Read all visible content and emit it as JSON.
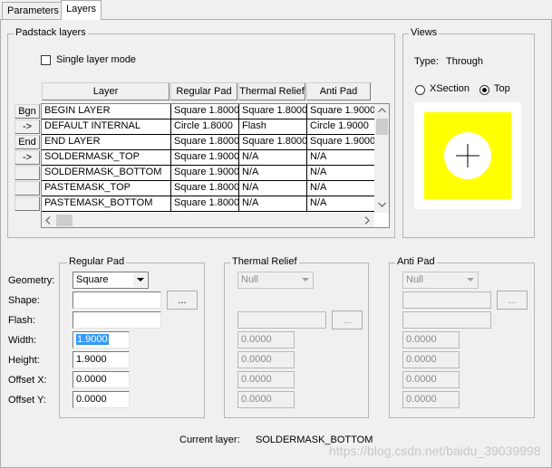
{
  "tabs": [
    {
      "label": "Parameters",
      "active": false
    },
    {
      "label": "Layers",
      "active": true
    }
  ],
  "padstack_layers": {
    "title": "Padstack layers",
    "single_layer_mode_label": "Single layer mode",
    "single_layer_mode_checked": false,
    "columns": [
      "Layer",
      "Regular Pad",
      "Thermal Relief",
      "Anti Pad"
    ],
    "row_buttons": [
      "Bgn",
      "->",
      "End",
      "->",
      "",
      "",
      ""
    ],
    "rows": [
      {
        "layer": "BEGIN LAYER",
        "regular": "Square 1.8000",
        "thermal": "Square 1.8000",
        "anti": "Square 1.9000"
      },
      {
        "layer": "DEFAULT INTERNAL",
        "regular": "Circle 1.8000",
        "thermal": "Flash",
        "anti": "Circle 1.9000"
      },
      {
        "layer": "END LAYER",
        "regular": "Square 1.8000",
        "thermal": "Square 1.8000",
        "anti": "Square 1.9000"
      },
      {
        "layer": "SOLDERMASK_TOP",
        "regular": "Square 1.9000",
        "thermal": "N/A",
        "anti": "N/A"
      },
      {
        "layer": "SOLDERMASK_BOTTOM",
        "regular": "Square 1.9000",
        "thermal": "N/A",
        "anti": "N/A"
      },
      {
        "layer": "PASTEMASK_TOP",
        "regular": "Square 1.8000",
        "thermal": "N/A",
        "anti": "N/A"
      },
      {
        "layer": "PASTEMASK_BOTTOM",
        "regular": "Square 1.8000",
        "thermal": "N/A",
        "anti": "N/A"
      }
    ]
  },
  "views": {
    "title": "Views",
    "type_label": "Type:",
    "type_value": "Through",
    "xsection_label": "XSection",
    "top_label": "Top",
    "selected": "Top",
    "preview_color": "#ffff00"
  },
  "field_labels": {
    "geometry": "Geometry:",
    "shape": "Shape:",
    "flash": "Flash:",
    "width": "Width:",
    "height": "Height:",
    "offset_x": "Offset X:",
    "offset_y": "Offset Y:"
  },
  "regular_pad": {
    "title": "Regular Pad",
    "geometry": "Square",
    "shape": "",
    "flash": "",
    "width": "1.9000",
    "height": "1.9000",
    "offset_x": "0.0000",
    "offset_y": "0.0000",
    "browse_label": "..."
  },
  "thermal_relief": {
    "title": "Thermal Relief",
    "geometry": "Null",
    "flash": "",
    "width": "0.0000",
    "height": "0.0000",
    "offset_x": "0.0000",
    "offset_y": "0.0000",
    "browse_label": "..."
  },
  "anti_pad": {
    "title": "Anti Pad",
    "geometry": "Null",
    "shape": "",
    "flash": "",
    "width": "0.0000",
    "height": "0.0000",
    "offset_x": "0.0000",
    "offset_y": "0.0000",
    "browse_label": "..."
  },
  "current_layer": {
    "label": "Current layer:",
    "value": "SOLDERMASK_BOTTOM"
  },
  "watermark": "https://blog.csdn.net/baidu_39039998",
  "colors": {
    "selection": "#3399ff",
    "preview": "#ffff00"
  }
}
